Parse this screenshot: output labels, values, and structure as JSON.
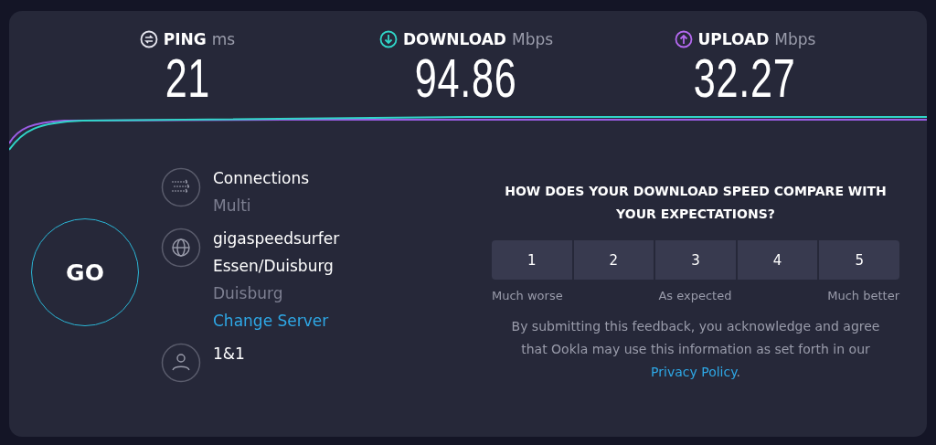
{
  "metrics": [
    {
      "kind": "ping",
      "label": "PING",
      "unit": "ms",
      "value": "21"
    },
    {
      "kind": "download",
      "label": "DOWNLOAD",
      "unit": "Mbps",
      "value": "94.86"
    },
    {
      "kind": "upload",
      "label": "UPLOAD",
      "unit": "Mbps",
      "value": "32.27"
    }
  ],
  "go_button": "GO",
  "info": [
    {
      "kind": "connections",
      "lines": [
        {
          "text": "Connections",
          "kind": "primary"
        },
        {
          "text": "Multi",
          "kind": "secondary"
        }
      ]
    },
    {
      "kind": "server",
      "lines": [
        {
          "text": "gigaspeedsurfer",
          "kind": "primary"
        },
        {
          "text": "Essen/Duisburg",
          "kind": "primary"
        },
        {
          "text": "Duisburg",
          "kind": "secondary"
        },
        {
          "text": "Change Server",
          "kind": "link"
        }
      ]
    },
    {
      "kind": "provider",
      "lines": [
        {
          "text": "1&1",
          "kind": "primary"
        }
      ]
    }
  ],
  "feedback": {
    "question": "HOW DOES YOUR DOWNLOAD SPEED COMPARE WITH YOUR EXPECTATIONS?",
    "ratings": [
      "1",
      "2",
      "3",
      "4",
      "5"
    ],
    "scale_labels": [
      "Much worse",
      "As expected",
      "Much better"
    ],
    "disclaimer": "By submitting this feedback, you acknowledge and agree that Ookla may use this information as set forth in our",
    "link": "Privacy Policy",
    "end": "."
  }
}
